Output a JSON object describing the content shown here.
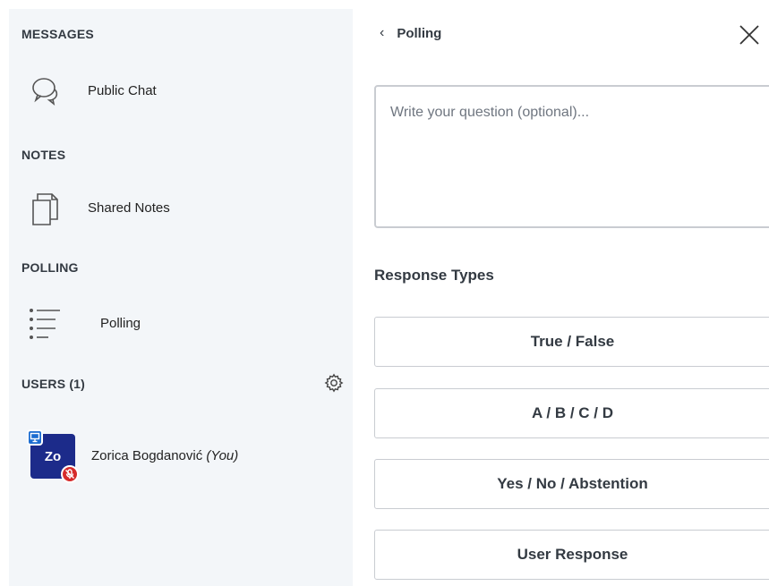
{
  "sidebar": {
    "messages_title": "MESSAGES",
    "public_chat_label": "Public Chat",
    "notes_title": "NOTES",
    "shared_notes_label": "Shared Notes",
    "polling_title": "POLLING",
    "polling_label": "Polling",
    "users_title": "USERS (1)"
  },
  "user": {
    "initials": "Zo",
    "name": "Zorica Bogdanović",
    "you_suffix": "(You)"
  },
  "panel": {
    "back_label": "Polling",
    "question_placeholder": "Write your question (optional)...",
    "response_types_title": "Response Types",
    "response_types": [
      "True / False",
      "A / B / C / D",
      "Yes / No / Abstention",
      "User Response"
    ]
  },
  "colors": {
    "sidebar_bg": "#f3f6f9",
    "avatar_bg": "#1c2b8a",
    "presenter_badge": "#1c6dd0",
    "mic_badge": "#d62b2b",
    "border": "#c9ccd1"
  }
}
